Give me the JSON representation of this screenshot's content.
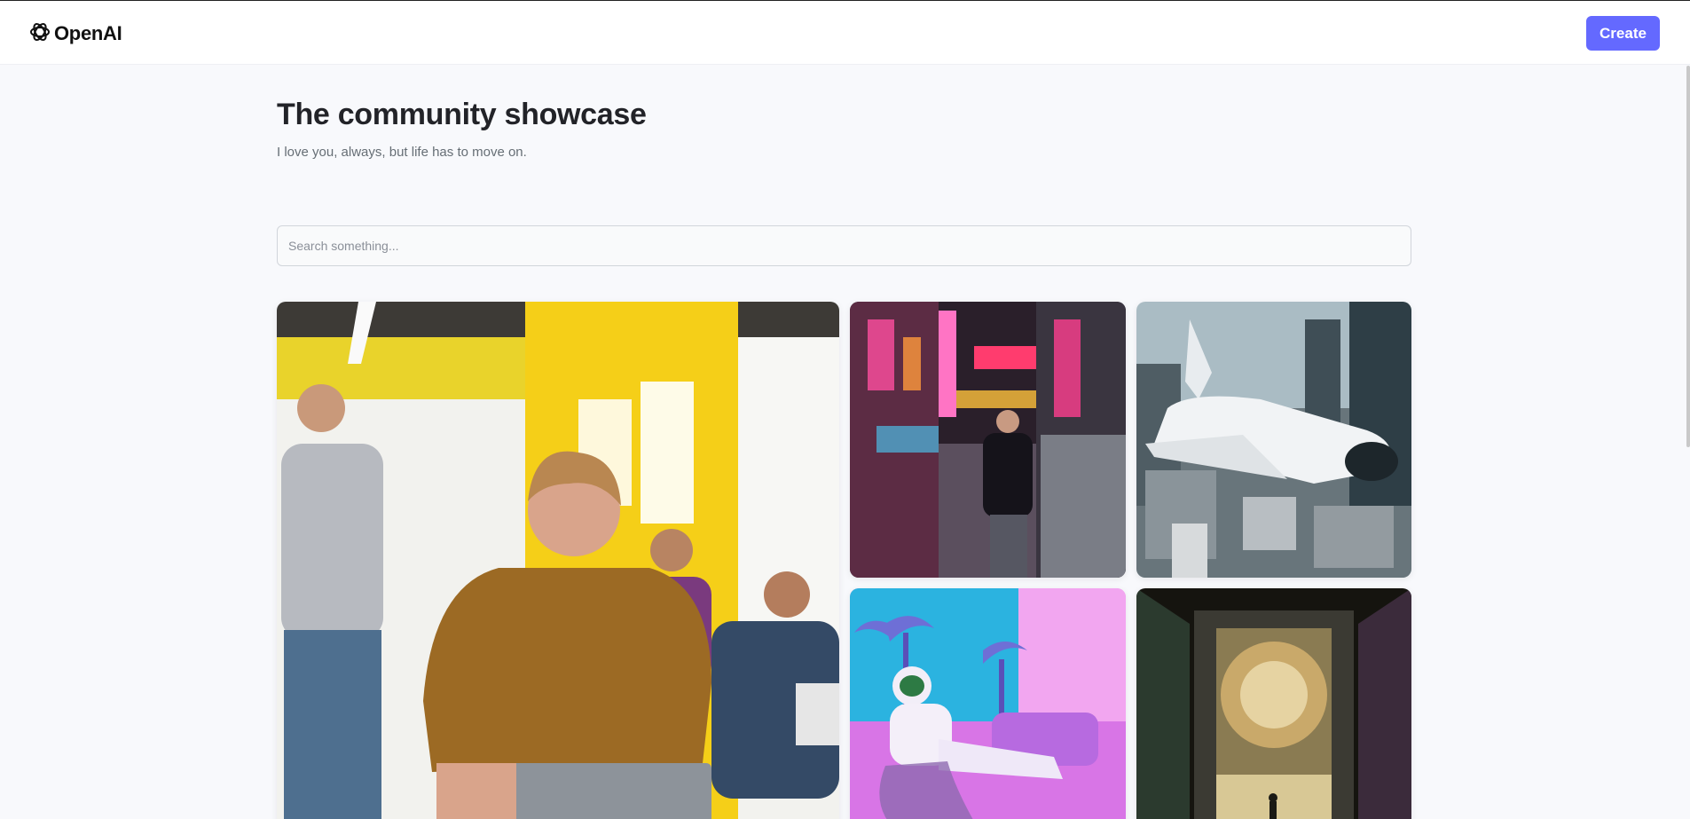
{
  "header": {
    "logo_text": "OpenAI",
    "logo_icon": "openai-logo-icon",
    "create_label": "Create"
  },
  "hero": {
    "title": "The community showcase",
    "subtitle": "I love you, always, but life has to move on."
  },
  "search": {
    "placeholder": "Search something..."
  },
  "gallery": {
    "images": [
      "laughing-man-with-laptop-office-image",
      "neon-street-man-walking-image",
      "space-shuttle-over-city-image",
      "astronaut-lounging-pink-room-image",
      "portal-doorway-figure-image"
    ]
  },
  "colors": {
    "accent": "#6469ff",
    "background": "#f8f9fc",
    "title": "#222328",
    "subtitle": "#666e75"
  }
}
